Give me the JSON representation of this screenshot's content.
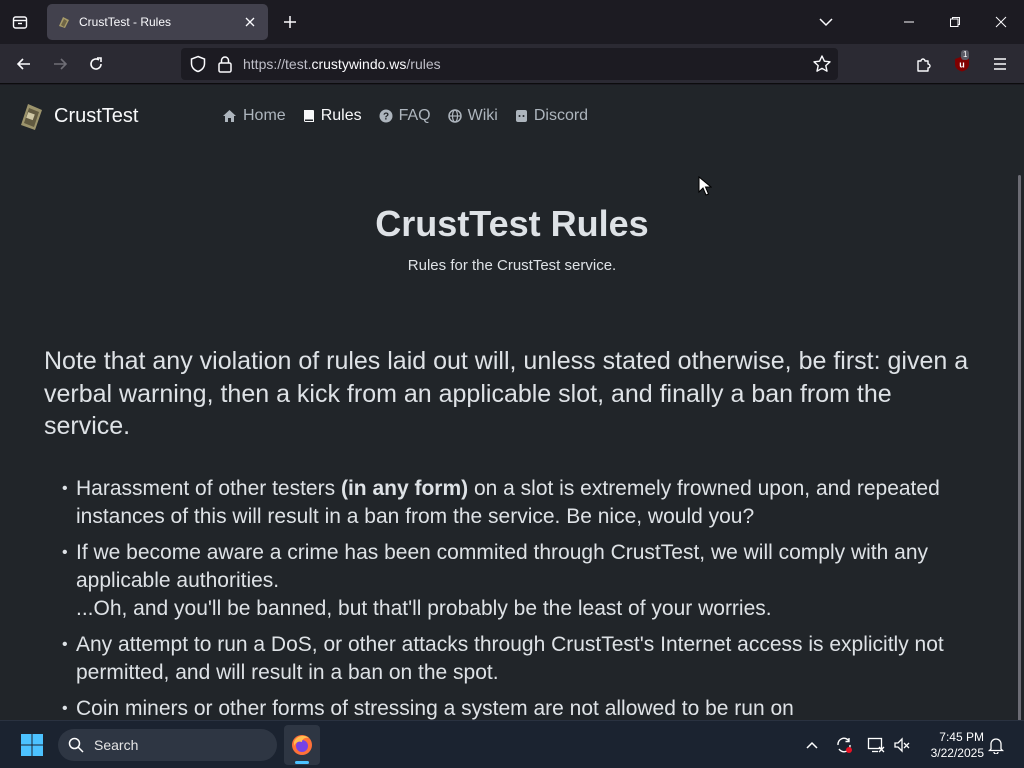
{
  "browser": {
    "tab_title": "CrustTest - Rules",
    "url_prefix": "https://test.",
    "url_domain": "crustywindo.ws",
    "url_path": "/rules",
    "extension_badge": "1"
  },
  "site": {
    "brand": "CrustTest",
    "nav": [
      {
        "label": "Home",
        "icon": "home-icon"
      },
      {
        "label": "Rules",
        "icon": "book-icon",
        "active": true
      },
      {
        "label": "FAQ",
        "icon": "question-circle-icon"
      },
      {
        "label": "Wiki",
        "icon": "globe-icon"
      },
      {
        "label": "Discord",
        "icon": "discord-icon"
      }
    ]
  },
  "page": {
    "title": "CrustTest Rules",
    "subtitle": "Rules for the CrustTest service.",
    "note": "Note that any violation of rules laid out will, unless stated otherwise, be first: given a verbal warning, then a kick from an applicable slot, and finally a ban from the service.",
    "rules": {
      "r1_before": "Harassment of other testers ",
      "r1_bold": "(in any form)",
      "r1_after": " on a slot is extremely frowned upon, and repeated instances of this will result in a ban from the service. Be nice, would you?",
      "r2_line1": "If we become aware a crime has been commited through CrustTest, we will comply with any applicable authorities.",
      "r2_line2": "...Oh, and you'll be banned, but that'll probably be the least of your worries.",
      "r3": "Any attempt to run a DoS, or other attacks through CrustTest's Internet access is explicitly not permitted, and will result in a ban on the spot.",
      "r4": "Coin miners or other forms of stressing a system are not allowed to be run on"
    }
  },
  "taskbar": {
    "search_label": "Search",
    "time": "7:45 PM",
    "date": "3/22/2025"
  },
  "colors": {
    "page_bg": "#212529",
    "chrome_bg": "#1c1b22",
    "taskbar_bg": "#1b2330",
    "accent": "#4cc2ff"
  }
}
